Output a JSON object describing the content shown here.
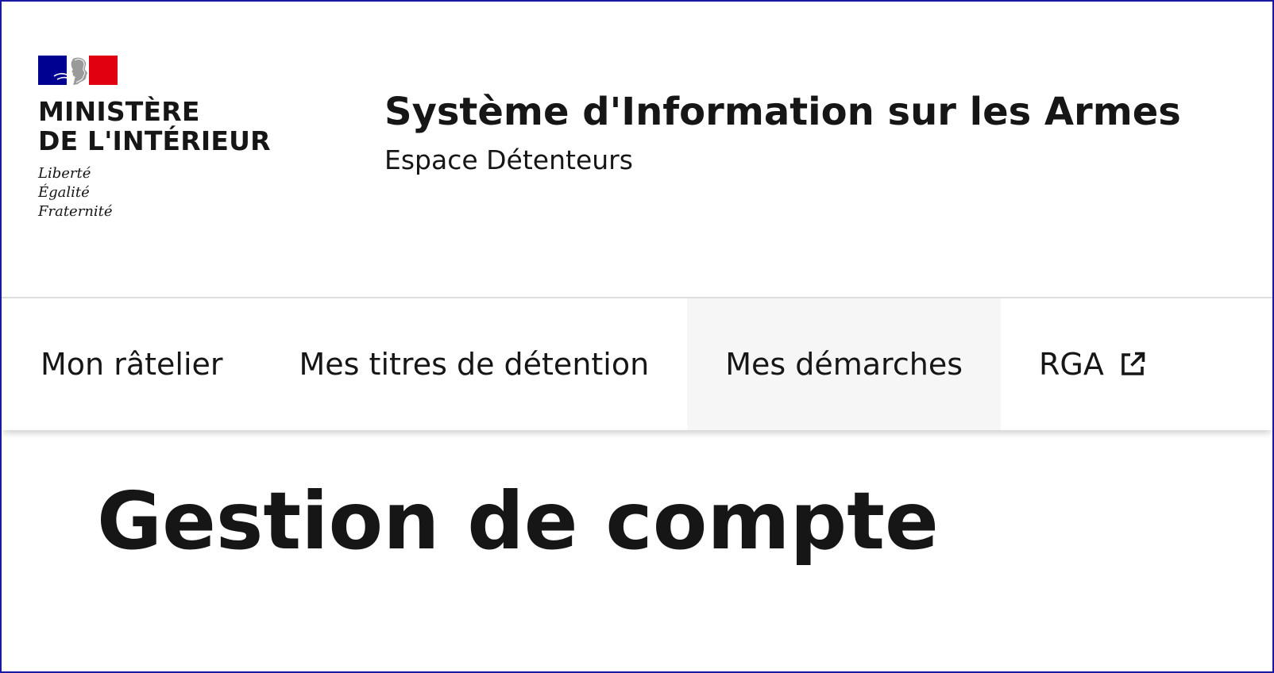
{
  "header": {
    "logo": {
      "icon": "marianne-flag-icon",
      "flag_colors": [
        "#000091",
        "#ffffff",
        "#e1000f"
      ],
      "ministry_line1": "MINISTÈRE",
      "ministry_line2": "DE L'INTÉRIEUR",
      "motto_line1": "Liberté",
      "motto_line2": "Égalité",
      "motto_line3": "Fraternité"
    },
    "service_title": "Système d'Information sur les Armes",
    "service_tagline": "Espace Détenteurs"
  },
  "nav": {
    "items": [
      {
        "label": "Mon râtelier",
        "active": false
      },
      {
        "label": "Mes titres de détention",
        "active": false
      },
      {
        "label": "Mes démarches",
        "active": true
      },
      {
        "label": "RGA",
        "active": false,
        "icon": "external-link-icon"
      }
    ]
  },
  "main": {
    "title": "Gestion de compte"
  },
  "colors": {
    "text": "#161616",
    "active_tab_bg": "#f6f6f6",
    "frame_border": "#1a1aa0"
  }
}
